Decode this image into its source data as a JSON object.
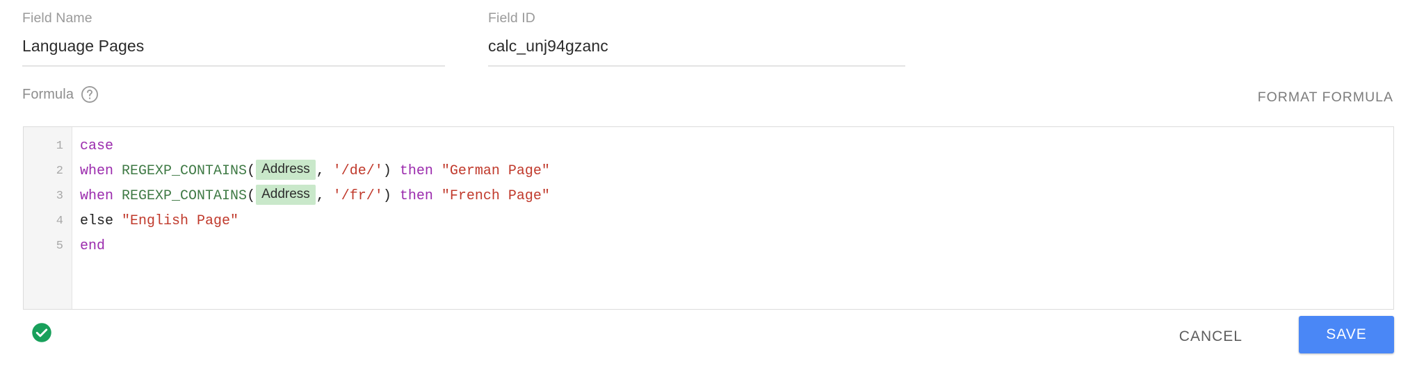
{
  "fields": {
    "name": {
      "label": "Field Name",
      "value": "Language Pages",
      "placeholder": "Field Name"
    },
    "id": {
      "label": "Field ID",
      "value": "calc_unj94gzanc",
      "placeholder": "Field ID"
    }
  },
  "formula": {
    "label": "Formula",
    "help_icon": "question-mark-circle-icon",
    "format_button": "FORMAT FORMULA",
    "line_numbers": [
      "1",
      "2",
      "3",
      "4",
      "5"
    ],
    "lines": [
      {
        "number": "1",
        "tokens": [
          {
            "kind": "keyword",
            "text": "case"
          }
        ]
      },
      {
        "number": "2",
        "tokens": [
          {
            "kind": "keyword",
            "text": "when"
          },
          {
            "kind": "plain",
            "text": " "
          },
          {
            "kind": "function",
            "text": "REGEXP_CONTAINS"
          },
          {
            "kind": "punctuation",
            "text": "("
          },
          {
            "kind": "chip",
            "text": "Address"
          },
          {
            "kind": "punctuation",
            "text": ", "
          },
          {
            "kind": "regex",
            "text": "'/de/'"
          },
          {
            "kind": "punctuation",
            "text": ") "
          },
          {
            "kind": "keyword",
            "text": "then"
          },
          {
            "kind": "plain",
            "text": " "
          },
          {
            "kind": "string",
            "text": "\"German Page\""
          }
        ]
      },
      {
        "number": "3",
        "tokens": [
          {
            "kind": "keyword",
            "text": "when"
          },
          {
            "kind": "plain",
            "text": " "
          },
          {
            "kind": "function",
            "text": "REGEXP_CONTAINS"
          },
          {
            "kind": "punctuation",
            "text": "("
          },
          {
            "kind": "chip",
            "text": "Address"
          },
          {
            "kind": "punctuation",
            "text": ", "
          },
          {
            "kind": "regex",
            "text": "'/fr/'"
          },
          {
            "kind": "punctuation",
            "text": ") "
          },
          {
            "kind": "keyword",
            "text": "then"
          },
          {
            "kind": "plain",
            "text": " "
          },
          {
            "kind": "string",
            "text": "\"French Page\""
          }
        ]
      },
      {
        "number": "4",
        "tokens": [
          {
            "kind": "plain",
            "text": "else"
          },
          {
            "kind": "plain",
            "text": " "
          },
          {
            "kind": "string",
            "text": "\"English Page\""
          }
        ]
      },
      {
        "number": "5",
        "tokens": [
          {
            "kind": "keyword",
            "text": "end"
          }
        ]
      }
    ]
  },
  "footer": {
    "status_icon": "valid-check-circle-icon",
    "status_meaning": "formula-valid",
    "cancel_label": "CANCEL",
    "save_label": "SAVE"
  },
  "colors": {
    "save_button_bg": "#4a87f6",
    "status_valid": "#18a05b",
    "keyword": "#9b2bad",
    "function": "#3f7a45",
    "string": "#c0392b",
    "chip_bg": "#c9e8ca",
    "label_text": "#9a9a9a",
    "gutter_bg": "#f5f5f5"
  }
}
